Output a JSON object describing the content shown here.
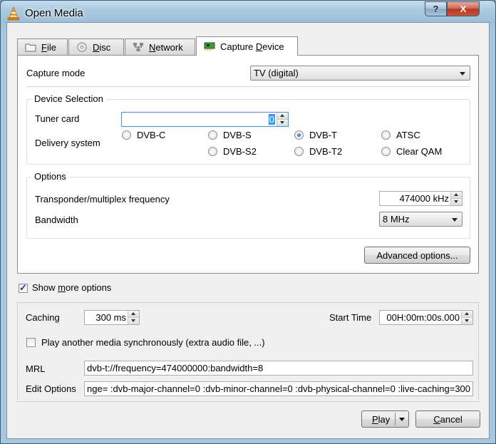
{
  "window": {
    "title": "Open Media",
    "help_label": "?",
    "close_label": "X"
  },
  "tabs": [
    {
      "label": "File",
      "ul": "F",
      "rest": "ile",
      "icon": "folder-icon"
    },
    {
      "label": "Disc",
      "ul": "D",
      "rest": "isc",
      "icon": "disc-icon"
    },
    {
      "label": "Network",
      "ul": "N",
      "rest": "etwork",
      "icon": "network-icon"
    },
    {
      "label": "Capture Device",
      "pre": "Capture ",
      "ul": "D",
      "rest": "evice",
      "icon": "capture-card-icon",
      "active": true
    }
  ],
  "capture": {
    "mode_label": "Capture mode",
    "mode_value": "TV (digital)"
  },
  "device_selection": {
    "title": "Device Selection",
    "tuner_label": "Tuner card",
    "tuner_value": "0",
    "delivery_label": "Delivery system",
    "options": [
      {
        "label": "DVB-C",
        "selected": false
      },
      {
        "label": "DVB-S",
        "selected": false
      },
      {
        "label": "DVB-T",
        "selected": true
      },
      {
        "label": "ATSC",
        "selected": false
      },
      {
        "label": "DVB-S2",
        "selected": false
      },
      {
        "label": "DVB-T2",
        "selected": false
      },
      {
        "label": "Clear QAM",
        "selected": false
      }
    ]
  },
  "options": {
    "title": "Options",
    "frequency_label": "Transponder/multiplex frequency",
    "frequency_value": "474000 kHz",
    "bandwidth_label": "Bandwidth",
    "bandwidth_value": "8 MHz",
    "advanced_label": "Advanced options..."
  },
  "show_more": {
    "pre": "Show ",
    "ul": "m",
    "rest": "ore options",
    "checked": true
  },
  "more": {
    "caching_label": "Caching",
    "caching_value": "300 ms",
    "start_time_label": "Start Time",
    "start_time_value": "00H:00m:00s.000",
    "play_sync_label": "Play another media synchronously (extra audio file, ...)",
    "play_sync_checked": false,
    "mrl_label": "MRL",
    "mrl_value": "dvb-t://frequency=474000000:bandwidth=8",
    "edit_options_label": "Edit Options",
    "edit_options_value": "nge= :dvb-major-channel=0 :dvb-minor-channel=0 :dvb-physical-channel=0 :live-caching=300"
  },
  "footer": {
    "play_ul": "P",
    "play_rest": "lay",
    "cancel_ul": "C",
    "cancel_rest": "ancel"
  },
  "colors": {
    "accent": "#3399ff",
    "close": "#c9543a",
    "frame": "#a9c9df"
  }
}
